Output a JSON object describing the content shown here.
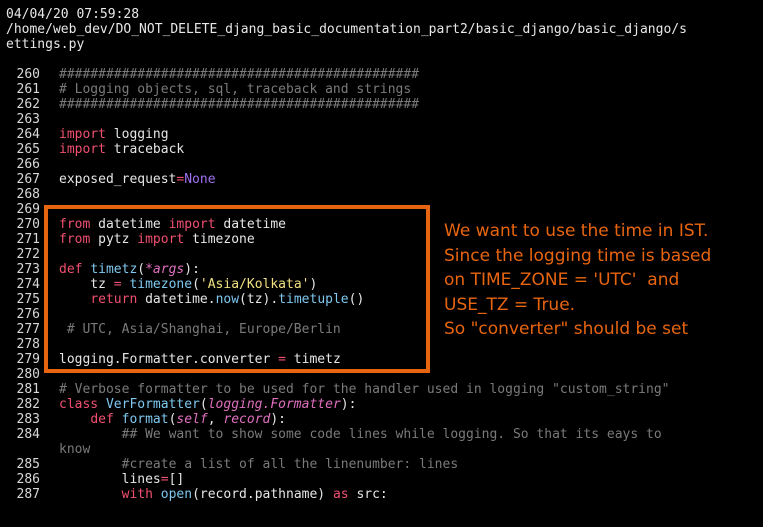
{
  "header": {
    "timestamp": "04/04/20 07:59:28",
    "path_line1": "/home/web_dev/DO_NOT_DELETE_djang_basic_documentation_part2/basic_django/basic_django/s",
    "path_line2": "ettings.py"
  },
  "lines": [
    {
      "n": "260",
      "segs": [
        {
          "t": "##############################################",
          "c": "cm"
        }
      ]
    },
    {
      "n": "261",
      "segs": [
        {
          "t": "# Logging objects, sql, traceback and strings",
          "c": "cm"
        }
      ]
    },
    {
      "n": "262",
      "segs": [
        {
          "t": "##############################################",
          "c": "cm"
        }
      ]
    },
    {
      "n": "263",
      "segs": []
    },
    {
      "n": "264",
      "segs": [
        {
          "t": "import",
          "c": "kw"
        },
        {
          "t": " logging",
          "c": ""
        }
      ]
    },
    {
      "n": "265",
      "segs": [
        {
          "t": "import",
          "c": "kw"
        },
        {
          "t": " traceback",
          "c": ""
        }
      ]
    },
    {
      "n": "266",
      "segs": []
    },
    {
      "n": "267",
      "segs": [
        {
          "t": "exposed_request",
          "c": ""
        },
        {
          "t": "=",
          "c": "op"
        },
        {
          "t": "None",
          "c": "ob"
        }
      ]
    },
    {
      "n": "268",
      "segs": []
    },
    {
      "n": "269",
      "segs": []
    },
    {
      "n": "270",
      "segs": [
        {
          "t": "from",
          "c": "kw"
        },
        {
          "t": " datetime ",
          "c": ""
        },
        {
          "t": "import",
          "c": "kw"
        },
        {
          "t": " datetime",
          "c": ""
        }
      ]
    },
    {
      "n": "271",
      "segs": [
        {
          "t": "from",
          "c": "kw"
        },
        {
          "t": " pytz ",
          "c": ""
        },
        {
          "t": "import",
          "c": "kw"
        },
        {
          "t": " timezone",
          "c": ""
        }
      ]
    },
    {
      "n": "272",
      "segs": []
    },
    {
      "n": "273",
      "segs": [
        {
          "t": "def",
          "c": "kw"
        },
        {
          "t": " ",
          "c": ""
        },
        {
          "t": "timetz",
          "c": "fn"
        },
        {
          "t": "(",
          "c": ""
        },
        {
          "t": "*args",
          "c": "arg"
        },
        {
          "t": "):",
          "c": ""
        }
      ]
    },
    {
      "n": "274",
      "segs": [
        {
          "t": "    tz ",
          "c": ""
        },
        {
          "t": "=",
          "c": "op"
        },
        {
          "t": " ",
          "c": ""
        },
        {
          "t": "timezone",
          "c": "fn"
        },
        {
          "t": "(",
          "c": ""
        },
        {
          "t": "'Asia/Kolkata'",
          "c": "str"
        },
        {
          "t": ")",
          "c": ""
        }
      ]
    },
    {
      "n": "275",
      "segs": [
        {
          "t": "    ",
          "c": ""
        },
        {
          "t": "return",
          "c": "kw"
        },
        {
          "t": " datetime.",
          "c": ""
        },
        {
          "t": "now",
          "c": "fn"
        },
        {
          "t": "(tz).",
          "c": ""
        },
        {
          "t": "timetuple",
          "c": "fn"
        },
        {
          "t": "()",
          "c": ""
        }
      ]
    },
    {
      "n": "276",
      "segs": []
    },
    {
      "n": "277",
      "segs": [
        {
          "t": " # UTC, Asia/Shanghai, Europe/Berlin",
          "c": "cm"
        }
      ]
    },
    {
      "n": "278",
      "segs": []
    },
    {
      "n": "279",
      "segs": [
        {
          "t": "logging.Formatter.converter ",
          "c": ""
        },
        {
          "t": "=",
          "c": "op"
        },
        {
          "t": " timetz",
          "c": ""
        }
      ]
    },
    {
      "n": "280",
      "segs": []
    },
    {
      "n": "281",
      "segs": [
        {
          "t": "# Verbose formatter to be used for the handler used in logging \"custom_string\"",
          "c": "cm"
        }
      ]
    },
    {
      "n": "282",
      "segs": [
        {
          "t": "class",
          "c": "kw"
        },
        {
          "t": " ",
          "c": ""
        },
        {
          "t": "VerFormatter",
          "c": "fn"
        },
        {
          "t": "(",
          "c": ""
        },
        {
          "t": "logging.Formatter",
          "c": "arg"
        },
        {
          "t": "):",
          "c": ""
        }
      ]
    },
    {
      "n": "283",
      "segs": [
        {
          "t": "    ",
          "c": ""
        },
        {
          "t": "def",
          "c": "kw"
        },
        {
          "t": " ",
          "c": ""
        },
        {
          "t": "format",
          "c": "fn"
        },
        {
          "t": "(",
          "c": ""
        },
        {
          "t": "self",
          "c": "arg"
        },
        {
          "t": ", ",
          "c": ""
        },
        {
          "t": "record",
          "c": "arg"
        },
        {
          "t": "):",
          "c": ""
        }
      ]
    },
    {
      "n": "284",
      "segs": [
        {
          "t": "        ## We want to show some code lines while logging. So that its eays to",
          "c": "cm"
        }
      ],
      "wrap": "know"
    },
    {
      "n": "285",
      "segs": [
        {
          "t": "        #create a list of all the linenumber: lines",
          "c": "cm"
        }
      ]
    },
    {
      "n": "286",
      "segs": [
        {
          "t": "        lines",
          "c": ""
        },
        {
          "t": "=",
          "c": "op"
        },
        {
          "t": "[]",
          "c": ""
        }
      ]
    },
    {
      "n": "287",
      "segs": [
        {
          "t": "        ",
          "c": ""
        },
        {
          "t": "with",
          "c": "kw"
        },
        {
          "t": " ",
          "c": ""
        },
        {
          "t": "open",
          "c": "fn"
        },
        {
          "t": "(record.pathname) ",
          "c": ""
        },
        {
          "t": "as",
          "c": "kw"
        },
        {
          "t": " src:",
          "c": ""
        }
      ]
    }
  ],
  "annotation": {
    "line1": "We want to use the time in IST.",
    "line2": "Since the logging time is based",
    "line3": "on TIME_ZONE = 'UTC'  and",
    "line4": "USE_TZ = True.",
    "line5": "So \"converter\" should be set"
  },
  "colors": {
    "background": "#000000",
    "highlight": "#e8650f",
    "keyword": "#f05070",
    "comment": "#7a7a7a",
    "string": "#f0e080",
    "function": "#7ec8f0",
    "none_constant": "#a070f0"
  }
}
